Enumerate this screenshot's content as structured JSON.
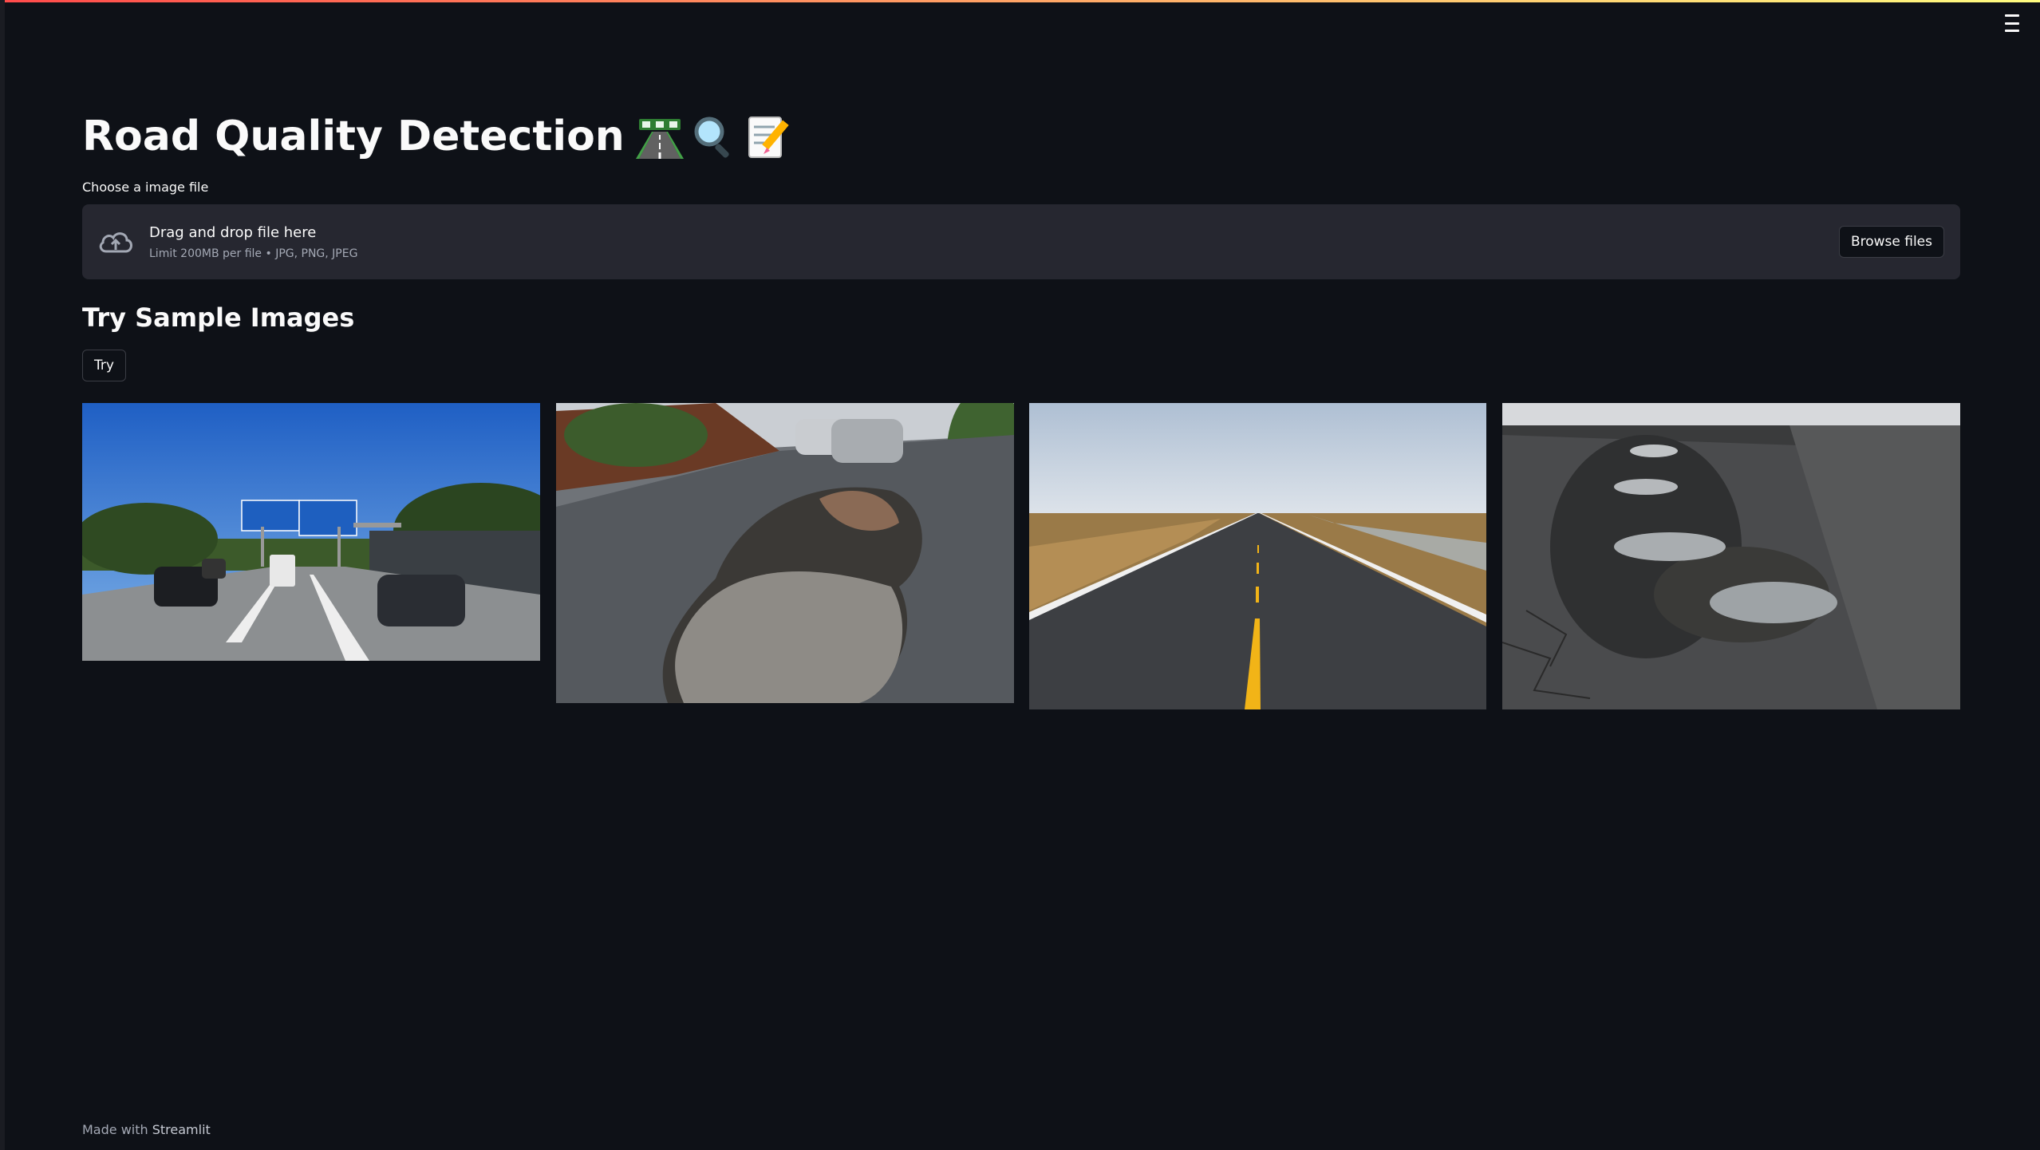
{
  "app": {
    "title": "Road Quality Detection",
    "title_emojis": [
      "road-emoji",
      "magnifier-emoji",
      "memo-emoji"
    ]
  },
  "uploader": {
    "label": "Choose a image file",
    "drag_text": "Drag and drop file here",
    "limit_text": "Limit 200MB per file • JPG, PNG, JPEG",
    "browse_label": "Browse files",
    "icon": "cloud-upload-icon"
  },
  "samples": {
    "heading": "Try Sample Images",
    "try_label": "Try",
    "images": [
      {
        "name": "highway-with-signs"
      },
      {
        "name": "wet-pothole-road"
      },
      {
        "name": "straight-open-road"
      },
      {
        "name": "potholes-cracked-asphalt"
      }
    ]
  },
  "footer": {
    "prefix": "Made with",
    "brand": "Streamlit"
  },
  "colors": {
    "background": "#0e1117",
    "panel": "#262730",
    "text": "#fafafa",
    "muted": "#a3a8b4"
  }
}
